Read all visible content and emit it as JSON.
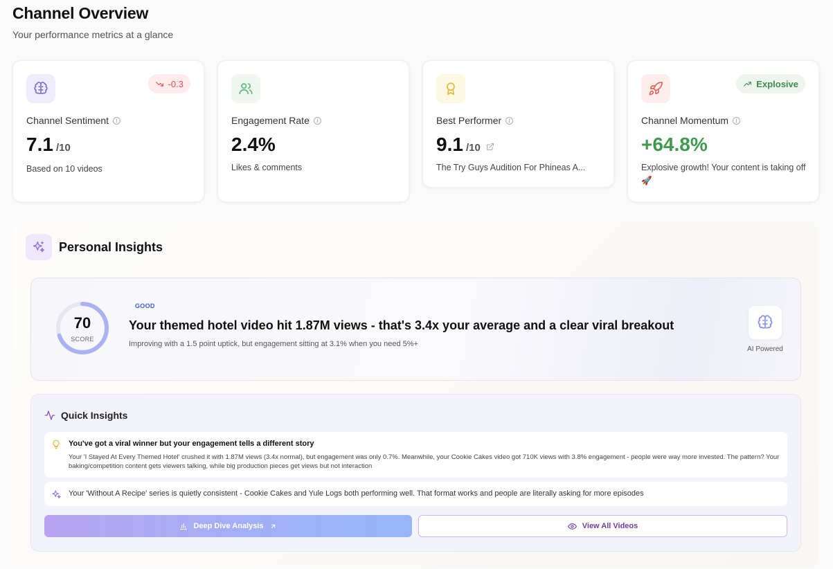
{
  "header": {
    "title": "Channel Overview",
    "subtitle": "Your performance metrics at a glance"
  },
  "cards": [
    {
      "label": "Channel Sentiment",
      "value": "7.1",
      "suffix": "/10",
      "desc": "Based on 10 videos",
      "badge": "-0.3",
      "icon": "brain-icon",
      "accent": "#7c6cd6"
    },
    {
      "label": "Engagement Rate",
      "value": "2.4%",
      "desc": "Likes & comments",
      "icon": "users-icon",
      "accent": "#58b877"
    },
    {
      "label": "Best Performer",
      "value": "9.1",
      "suffix": "/10",
      "desc": "The Try Guys Audition For Phineas A...",
      "icon": "award-icon",
      "accent": "#e2b93b"
    },
    {
      "label": "Channel Momentum",
      "value": "+64.8%",
      "desc": "Explosive growth! Your content is taking off 🚀",
      "badge": "Explosive",
      "icon": "rocket-icon",
      "accent": "#e0655a",
      "value_color": "#3f9a4f"
    }
  ],
  "insights": {
    "title": "Personal Insights",
    "score": {
      "value": "70",
      "label": "SCORE",
      "fraction": 0.7,
      "status": "GOOD",
      "headline": "Your themed hotel video hit 1.87M views - that's 3.4x your average and a clear viral breakout",
      "subtext": "Improving with a 1.5 point uptick, but engagement sitting at 3.1% when you need 5%+",
      "ai_label": "AI Powered"
    },
    "quick": {
      "title": "Quick Insights",
      "items": [
        {
          "title": "You've got a viral winner but your engagement tells a different story",
          "text": "Your 'I Stayed At Every Themed Hotel' crushed it with 1.87M views (3.4x normal), but engagement was only 0.7%. Meanwhile, your Cookie Cakes video got 710K views with 3.8% engagement - people were way more invested. The pattern? Your baking/competition content gets viewers talking, while big production pieces get views but not interaction"
        },
        {
          "text": "Your 'Without A Recipe' series is quietly consistent - Cookie Cakes and Yule Logs both performing well. That format works and people are literally asking for more episodes"
        }
      ],
      "primary_button": "Deep Dive Analysis",
      "secondary_button": "View All Videos"
    }
  }
}
